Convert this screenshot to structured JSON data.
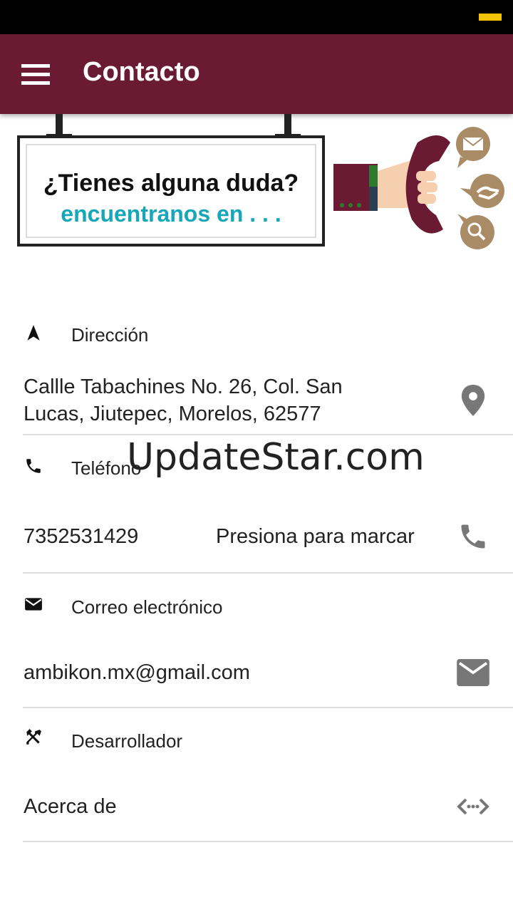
{
  "app_bar": {
    "title": "Contacto",
    "menu_icon": "hamburger-menu-icon"
  },
  "banner": {
    "line1": "¿Tienes alguna duda?",
    "line2": "encuentranos en . . .",
    "colors": {
      "accent": "#17a7b8",
      "brand": "#6a1a32"
    }
  },
  "sections": {
    "address": {
      "label": "Dirección",
      "value_line1": "Callle Tabachines No. 26, Col. San",
      "value_line2": "Lucas, Jiutepec, Morelos, 62577",
      "icon": "navigation-arrow-icon",
      "action_icon": "map-pin-icon"
    },
    "phone": {
      "label": "Teléfono",
      "value": "7352531429",
      "action_text": "Presiona para marcar",
      "icon": "phone-icon",
      "action_icon": "phone-icon"
    },
    "email": {
      "label": "Correo electrónico",
      "value": "ambikon.mx@gmail.com",
      "icon": "envelope-icon",
      "action_icon": "envelope-icon"
    },
    "developer": {
      "label": "Desarrollador",
      "value": "Acerca de",
      "icon": "tools-icon",
      "action_icon": "code-arrows-icon"
    }
  },
  "watermark": "UpdateStar.com"
}
